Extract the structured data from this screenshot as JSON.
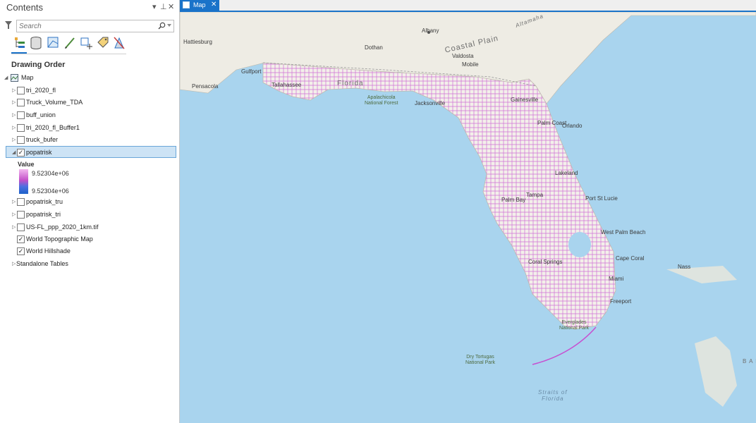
{
  "pane": {
    "title": "Contents",
    "controls": [
      "▾",
      "⊥",
      "✕"
    ],
    "search_placeholder": "Search",
    "drawing_order": "Drawing Order",
    "toolbar_icons": [
      "list-by-drawing-order-icon",
      "list-by-data-source-icon",
      "list-by-selection-icon",
      "list-by-editing-icon",
      "list-by-snapping-icon",
      "list-by-labeling-icon",
      "list-by-perspective-imagery-icon"
    ]
  },
  "tree": {
    "map": "Map",
    "layers": [
      {
        "name": "tri_2020_fl",
        "checked": false
      },
      {
        "name": "Truck_Volume_TDA",
        "checked": false
      },
      {
        "name": "buff_union",
        "checked": false
      },
      {
        "name": "tri_2020_fl_Buffer1",
        "checked": false
      },
      {
        "name": "truck_bufer",
        "checked": false
      },
      {
        "name": "popatrisk",
        "checked": true
      },
      {
        "name": "popatrisk_tru",
        "checked": false
      },
      {
        "name": "popatrisk_tri",
        "checked": false
      },
      {
        "name": "US-FL_ppp_2020_1km.tif",
        "checked": false
      },
      {
        "name": "World Topographic Map",
        "checked": true
      },
      {
        "name": "World Hillshade",
        "checked": true
      }
    ],
    "standalone": "Standalone Tables",
    "legend": {
      "title": "Value",
      "high": "9.52304e+06",
      "low": "9.52304e+06"
    }
  },
  "tab": {
    "label": "Map",
    "close": "✕"
  },
  "map": {
    "cities": [
      "Albany",
      "Hattiesburg",
      "Dothan",
      "Valdosta",
      "Mobile",
      "Gulfport",
      "Pensacola",
      "Tallahassee",
      "Jacksonville",
      "Gainesville",
      "Palm Coast",
      "Orlando",
      "Lakeland",
      "Tampa",
      "Palm Bay",
      "Port St Lucie",
      "West Palm Beach",
      "Cape Coral",
      "Coral Springs",
      "Miami",
      "Freeport",
      "Nass"
    ],
    "regions": [
      "Coastal Plain",
      "Florida",
      "Altamaha",
      "B A H"
    ],
    "parks": [
      "Apalachicola\nNational Forest",
      "Everglades\nNational Park",
      "Dry Tortugas\nNational Park"
    ],
    "water": [
      "Straits of\nFlorida"
    ]
  }
}
